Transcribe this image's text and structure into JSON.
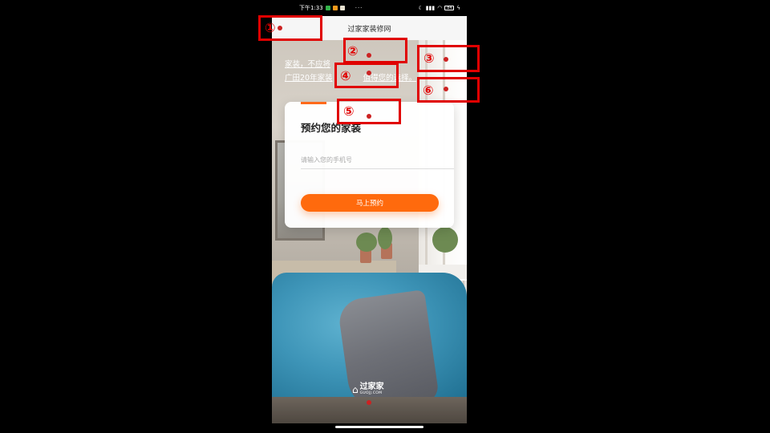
{
  "status_bar": {
    "time": "下午1:33",
    "more": "···",
    "battery": "84"
  },
  "nav": {
    "title": "过家家装修网"
  },
  "hero": {
    "line1": "家装，不应将",
    "line2": "广田20年家装",
    "line2_end": "值得您的选择。"
  },
  "form": {
    "title": "预约您的家装",
    "phone_placeholder": "请输入您的手机号",
    "submit_label": "马上预约"
  },
  "logo": {
    "name": "过家家",
    "url": "GUOJJ.COM"
  },
  "annotations": [
    {
      "label": "①"
    },
    {
      "label": "②"
    },
    {
      "label": "③"
    },
    {
      "label": "④"
    },
    {
      "label": "⑤"
    },
    {
      "label": "⑥"
    }
  ],
  "colors": {
    "accent": "#ff6a0d",
    "annotation": "#e00000"
  }
}
